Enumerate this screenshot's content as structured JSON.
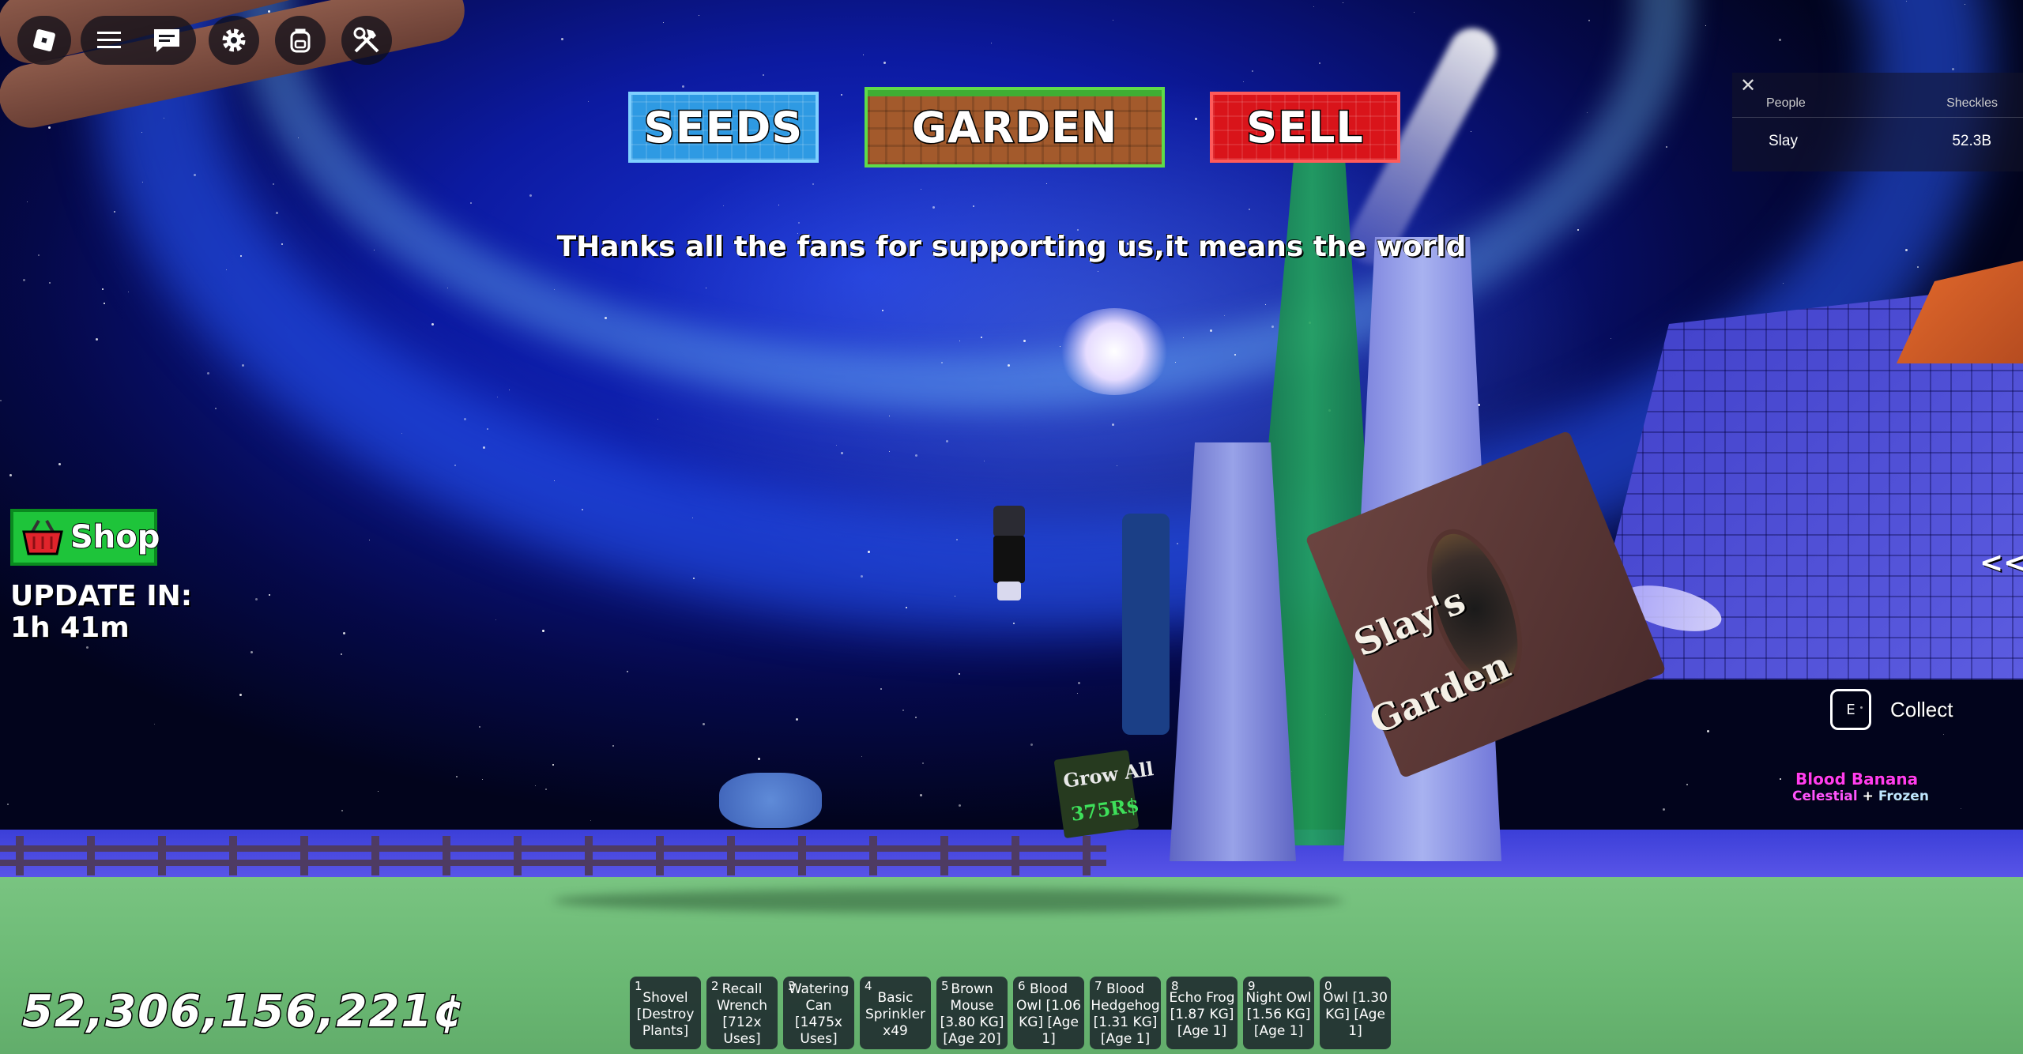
{
  "top_bar": {
    "roblox_icon": "roblox-logo-icon",
    "menu_icon": "hamburger-menu-icon",
    "chat_icon": "chat-icon",
    "settings_icon": "gear-icon",
    "backpack_icon": "backpack-icon",
    "tools_icon": "hammer-wrench-icon"
  },
  "nav": {
    "seeds": "SEEDS",
    "garden": "GARDEN",
    "sell": "SELL"
  },
  "announcement": "THanks all the fans for supporting us,it means the world",
  "leaderboard": {
    "close": "✕",
    "col_people": "People",
    "col_currency": "Sheckles",
    "rows": [
      {
        "name": "Slay",
        "value": "52.3B"
      }
    ]
  },
  "shop": {
    "label": "Shop",
    "icon": "basket-icon",
    "update_title": "UPDATE IN:",
    "update_time": "1h 41m"
  },
  "world": {
    "sign_line1": "Slay's",
    "sign_line2": "Garden",
    "grow_all_line1": "Grow All",
    "grow_all_line2": "375R$"
  },
  "collapse": "<<",
  "collect": {
    "key": "E",
    "label": "Collect"
  },
  "plant": {
    "name": "Blood Banana",
    "mutation1": "Celestial",
    "separator": " + ",
    "mutation2": "Frozen"
  },
  "money": "52,306,156,221¢",
  "hotbar": [
    {
      "num": "1",
      "label": "Shovel [Destroy Plants]"
    },
    {
      "num": "2",
      "label": "Recall Wrench [712x Uses]"
    },
    {
      "num": "3",
      "label": "Watering Can [1475x Uses]"
    },
    {
      "num": "4",
      "label": "Basic Sprinkler x49"
    },
    {
      "num": "5",
      "label": "Brown Mouse [3.80 KG] [Age 20]"
    },
    {
      "num": "6",
      "label": "Blood Owl [1.06 KG] [Age 1]"
    },
    {
      "num": "7",
      "label": "Blood Hedgehog [1.31 KG] [Age 1]"
    },
    {
      "num": "8",
      "label": "Echo Frog [1.87 KG] [Age 1]"
    },
    {
      "num": "9",
      "label": "Night Owl [1.56 KG] [Age 1]"
    },
    {
      "num": "0",
      "label": "Owl [1.30 KG] [Age 1]"
    }
  ],
  "colors": {
    "seeds": "#2e9ae3",
    "garden": "#a35a2c",
    "sell": "#d9141a",
    "shop": "#1ec43a",
    "ground": "#6ab873",
    "sky": "#0c1aa0"
  }
}
